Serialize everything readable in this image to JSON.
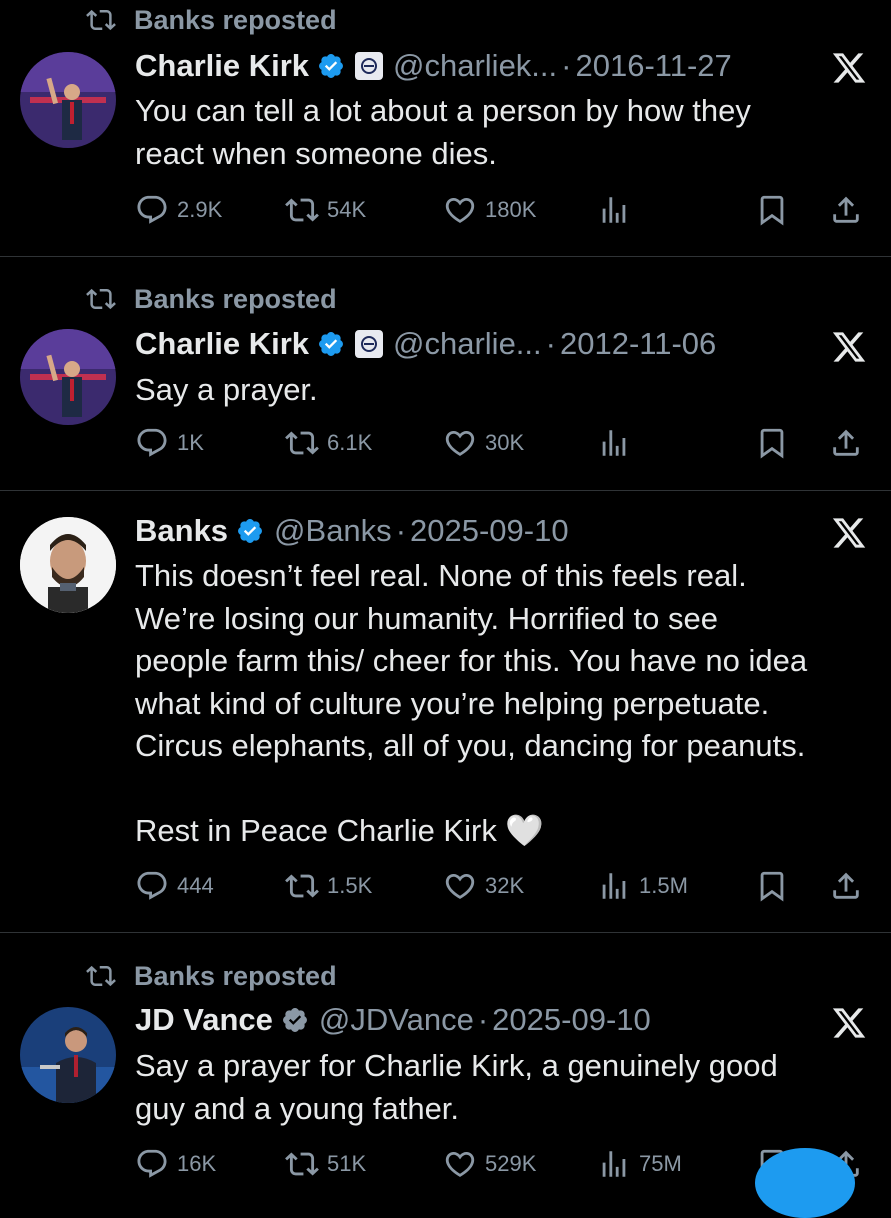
{
  "tweets": [
    {
      "repost_label": "Banks reposted",
      "name": "Charlie Kirk",
      "handle": "@charliek...",
      "date": "2016-11-27",
      "text": [
        "You can tell a lot about a person by how they",
        "react when someone dies."
      ],
      "replies": "2.9K",
      "reposts": "54K",
      "likes": "180K",
      "views": ""
    },
    {
      "repost_label": "Banks reposted",
      "name": "Charlie Kirk",
      "handle": "@charlie...",
      "date": "2012-11-06",
      "text": [
        "Say a prayer."
      ],
      "replies": "1K",
      "reposts": "6.1K",
      "likes": "30K",
      "views": ""
    },
    {
      "name": "Banks",
      "handle": "@Banks",
      "date": "2025-09-10",
      "text": [
        "This doesn’t feel real. None of this feels real.",
        "We’re losing our humanity. Horrified to see",
        "people farm this/ cheer for this. You have no idea",
        "what kind of culture you’re helping perpetuate.",
        "Circus elephants, all of you, dancing for peanuts.",
        "",
        "Rest in Peace Charlie Kirk 🤍"
      ],
      "replies": "444",
      "reposts": "1.5K",
      "likes": "32K",
      "views": "1.5M"
    },
    {
      "repost_label": "Banks reposted",
      "name": "JD Vance",
      "handle": "@JDVance",
      "date": "2025-09-10",
      "text": [
        "Say a prayer for Charlie Kirk, a genuinely good",
        "guy and a young father."
      ],
      "replies": "16K",
      "reposts": "51K",
      "likes": "529K",
      "views": "75M"
    }
  ],
  "colors": {
    "background": "#000000",
    "text": "#e7e9ea",
    "muted": "#8b98a5",
    "verified_blue": "#1d9bf0",
    "divider": "#2f3336"
  },
  "icons": [
    "repost-icon",
    "verified-badge-icon",
    "affiliate-badge-icon",
    "x-logo-icon",
    "reply-icon",
    "like-icon",
    "views-icon",
    "bookmark-icon",
    "share-icon"
  ]
}
